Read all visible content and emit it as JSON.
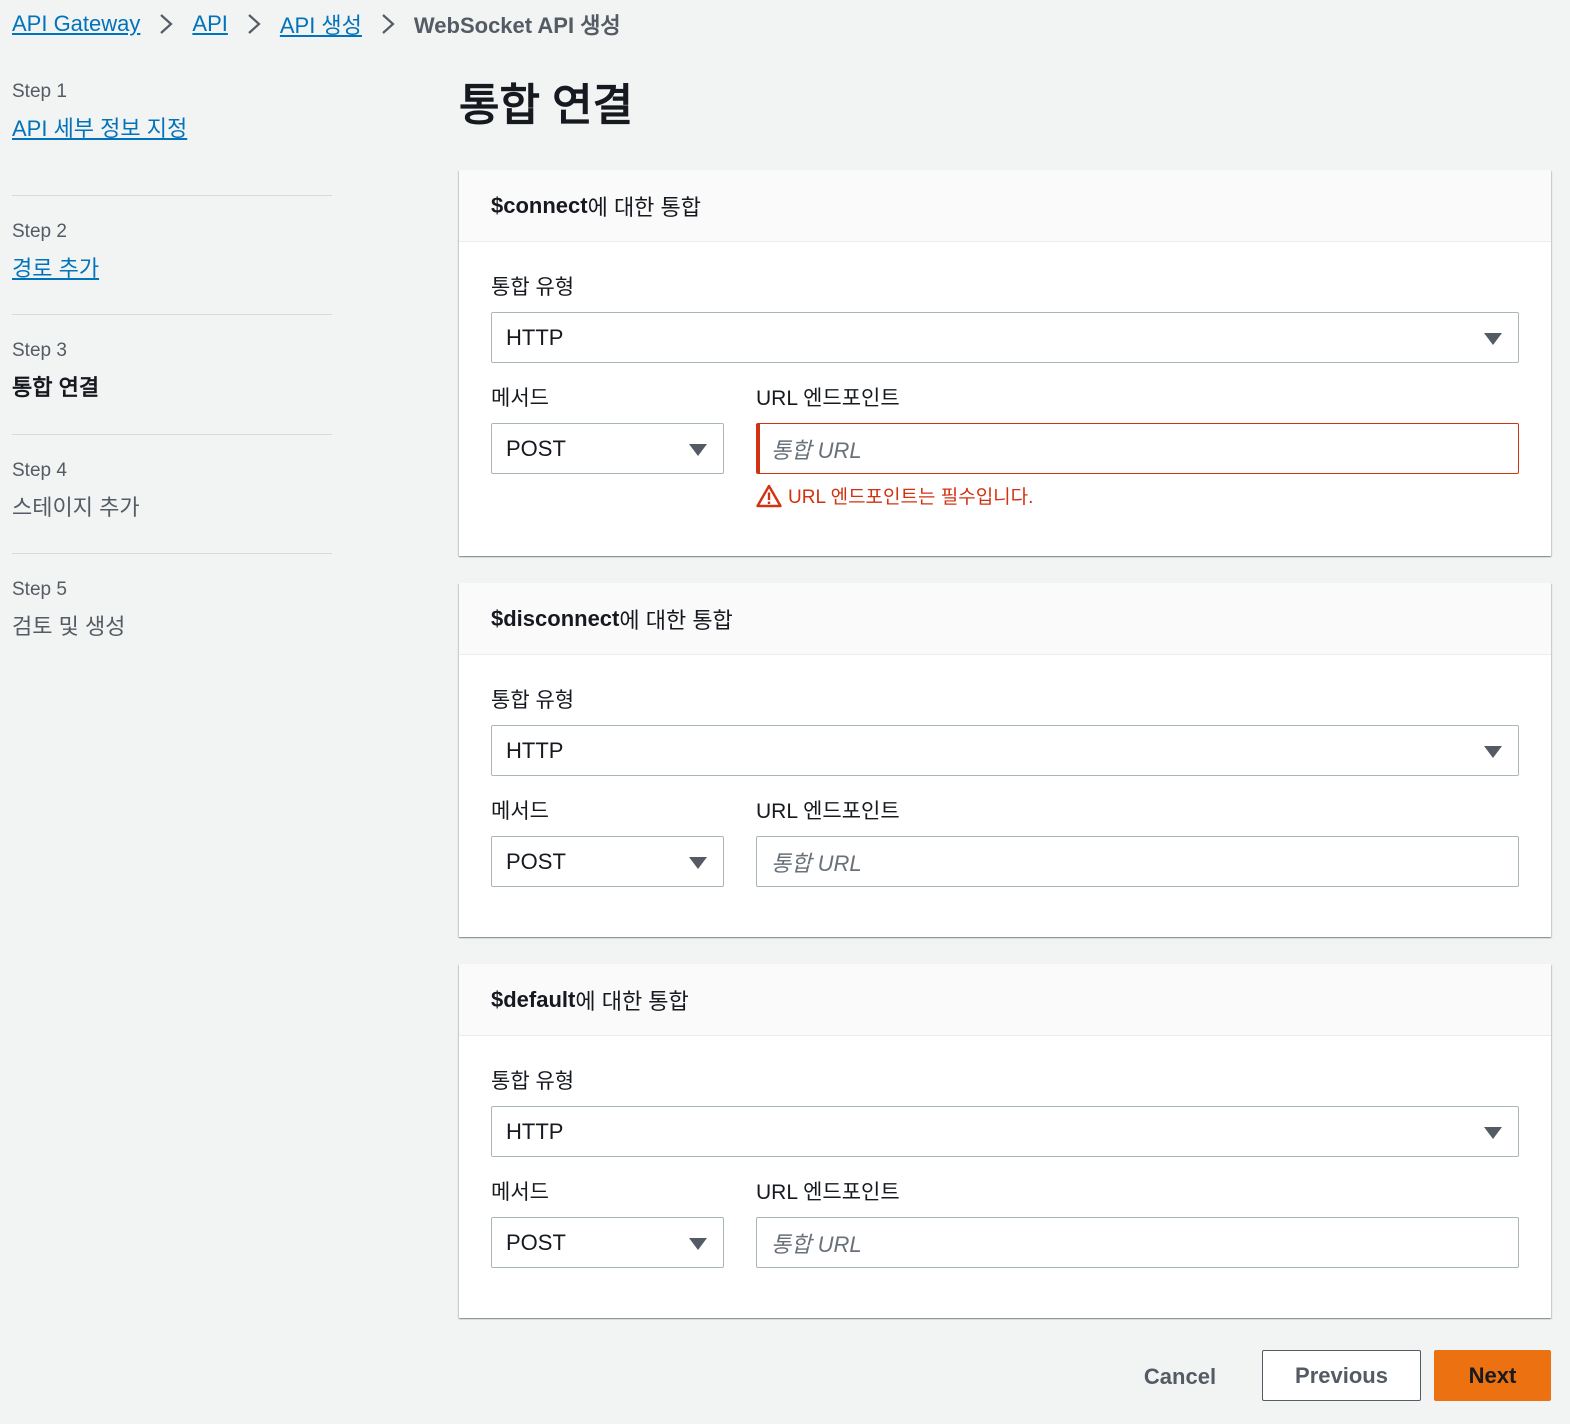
{
  "breadcrumb": {
    "items": [
      "API Gateway",
      "API",
      "API 생성"
    ],
    "current": "WebSocket API 생성"
  },
  "steps": [
    {
      "num": "Step 1",
      "title": "API 세부 정보 지정",
      "state": "link"
    },
    {
      "num": "Step 2",
      "title": "경로 추가",
      "state": "link"
    },
    {
      "num": "Step 3",
      "title": "통합 연결",
      "state": "current"
    },
    {
      "num": "Step 4",
      "title": "스테이지 추가",
      "state": "disabled"
    },
    {
      "num": "Step 5",
      "title": "검토 및 생성",
      "state": "disabled"
    }
  ],
  "page_title": "통합 연결",
  "panels": [
    {
      "route": "$connect",
      "header_suffix": "에 대한 통합",
      "type_label": "통합 유형",
      "type_value": "HTTP",
      "method_label": "메서드",
      "method_value": "POST",
      "url_label": "URL 엔드포인트",
      "url_placeholder": "통합 URL",
      "error": "URL 엔드포인트는 필수입니다."
    },
    {
      "route": "$disconnect",
      "header_suffix": "에 대한 통합",
      "type_label": "통합 유형",
      "type_value": "HTTP",
      "method_label": "메서드",
      "method_value": "POST",
      "url_label": "URL 엔드포인트",
      "url_placeholder": "통합 URL"
    },
    {
      "route": "$default",
      "header_suffix": "에 대한 통합",
      "type_label": "통합 유형",
      "type_value": "HTTP",
      "method_label": "메서드",
      "method_value": "POST",
      "url_label": "URL 엔드포인트",
      "url_placeholder": "통합 URL"
    }
  ],
  "actions": {
    "cancel": "Cancel",
    "previous": "Previous",
    "next": "Next"
  },
  "colors": {
    "link": "#0073bb",
    "error": "#d13212",
    "primary_button": "#ec7211",
    "background": "#f2f3f3"
  }
}
